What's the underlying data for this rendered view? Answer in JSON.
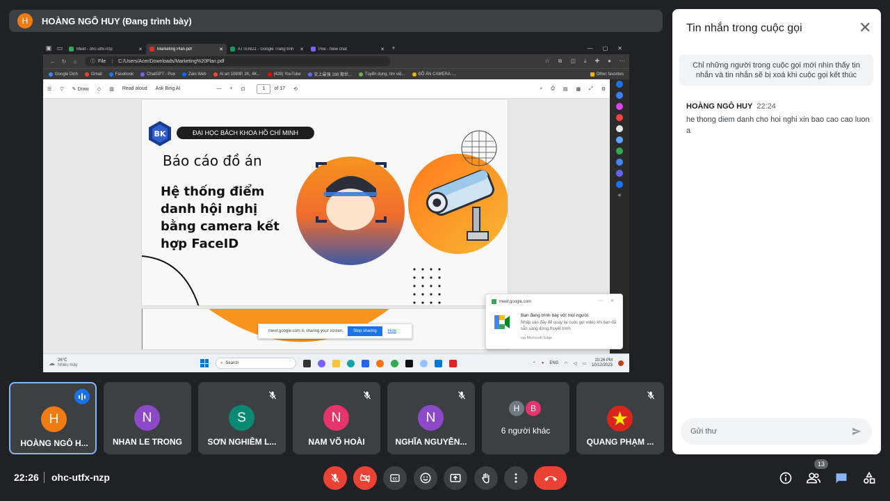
{
  "presenter": {
    "initial": "H",
    "label": "HOÀNG NGÔ HUY (Đang trình bày)"
  },
  "shared_screen": {
    "tabs": [
      {
        "title": "Meet - ohc-utfx-nzp"
      },
      {
        "title": "Marketing Plan.pdf"
      },
      {
        "title": "ATTEND1 - Google Trang tính"
      },
      {
        "title": "Poe - New chat"
      }
    ],
    "address": {
      "scheme": "File",
      "url": "C:/Users/Acer/Downloads/Marketing%20Plan.pdf"
    },
    "bookmarks": [
      "Google Dịch",
      "Gmail",
      "Facebook",
      "ChatGPT - Poe",
      "Zalo Web",
      "AI art 1080P, 2K, 4K...",
      "(428) YouTube",
      "史上最强 288 期世...",
      "Tuyển dụng, tìm việ...",
      "ĐỒ ÁN CAMERA -..."
    ],
    "other_favorites": "Other favorites",
    "pdf_toolbar": {
      "draw": "Draw",
      "read_aloud": "Read aloud",
      "ask_bing": "Ask Bing AI",
      "page": "1",
      "of_pages": "of 17"
    },
    "slide": {
      "university": "ĐẠI HỌC BÁCH KHOA HỒ CHÍ MINH",
      "logo": "BK",
      "title": "Báo cáo đồ án",
      "main_lines": [
        "Hệ thống điểm",
        "danh hội nghị",
        "bằng camera kết",
        "hợp FaceID"
      ]
    },
    "share_bar": {
      "text": "meet.google.com is sharing your screen.",
      "stop": "Stop sharing",
      "hide": "Hide"
    },
    "notification": {
      "source": "meet.google.com",
      "title": "Bạn đang trình bày với mọi người",
      "body": "Nhấp vào đây để quay lại cuộc gọi video khi bạn đã sẵn sàng dừng thuyết trình",
      "via": "via Microsoft Edge"
    },
    "taskbar": {
      "weather_temp": "26°C",
      "weather_desc": "Nhiều mây",
      "search": "Search",
      "lang": "ENG",
      "time": "10:26 PM",
      "date": "10/12/2023"
    }
  },
  "chat": {
    "title": "Tin nhắn trong cuộc gọi",
    "info": "Chỉ những người trong cuộc gọi mới nhìn thấy tin nhắn và tin nhắn sẽ bị xoá khi cuộc gọi kết thúc",
    "messages": [
      {
        "sender": "HOÀNG NGÔ HUY",
        "time": "22:24",
        "text": "he thong diem danh cho hoi nghi xin bao cao cao luon a"
      }
    ],
    "input_placeholder": "Gửi thư"
  },
  "participants": [
    {
      "initial": "H",
      "name": "HOÀNG NGÔ H...",
      "color": "#f07b12"
    },
    {
      "initial": "N",
      "name": "NHAN LE TRONG",
      "color": "#8e49c9"
    },
    {
      "initial": "S",
      "name": "SƠN NGHIÊM L...",
      "color": "#0b8a73"
    },
    {
      "initial": "N",
      "name": "NAM VÕ HOÀI",
      "color": "#e8346d"
    },
    {
      "initial": "N",
      "name": "NGHĨA NGUYỄN...",
      "color": "#8e49c9"
    },
    {
      "initials": [
        "H",
        "B"
      ],
      "name": "6 người khác",
      "colors": [
        "#6f7a85",
        "#e8346d"
      ]
    },
    {
      "name": "QUANG PHẠM ...",
      "avatar": "vietnam-flag"
    }
  ],
  "bottom": {
    "time": "22:26",
    "meeting_code": "ohc-utfx-nzp",
    "people_count": "13"
  },
  "colors": {
    "background": "#202124",
    "tile": "#3c4043",
    "danger": "#ea4335",
    "accent": "#8ab4f8"
  }
}
